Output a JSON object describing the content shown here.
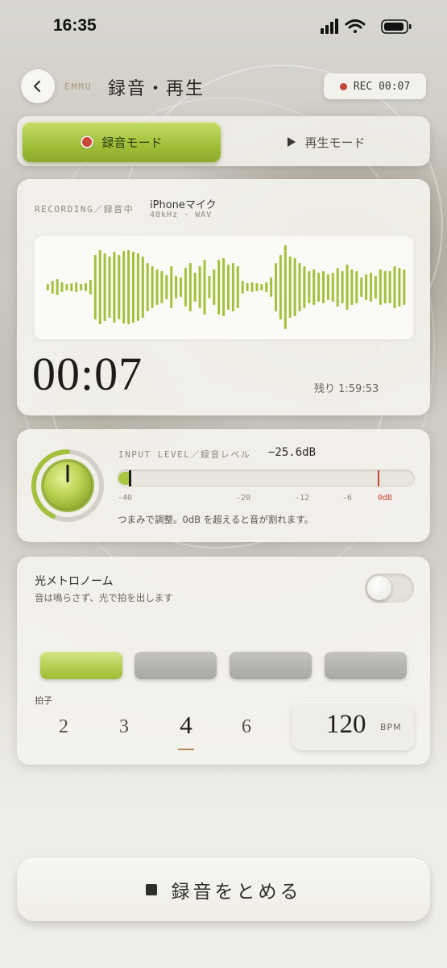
{
  "status_bar": {
    "time": "16:35",
    "icons": [
      "signal-icon",
      "wifi-icon",
      "battery-icon"
    ]
  },
  "header": {
    "brand": "EMMU",
    "title": "録音・再生",
    "rec_indicator": "REC 00:07"
  },
  "modes": {
    "record": "録音モード",
    "play": "再生モード",
    "active": "record"
  },
  "recording": {
    "status_label": "RECORDING／録音中",
    "mic_name": "iPhoneマイク",
    "mic_spec": "48kHz · WAV",
    "elapsed": "00:07",
    "remaining": "残り 1:59:53"
  },
  "input_level": {
    "label": "INPUT LEVEL／録音レベル",
    "value": "−25.6dB",
    "ticks": [
      "-40",
      "-20",
      "-12",
      "-6",
      "0dB"
    ],
    "hint": "つまみで調整。0dB を超えると音が割れます。"
  },
  "metronome": {
    "title": "光メトロノーム",
    "subtitle": "音は鳴らさず、光で拍を出します",
    "enabled": false,
    "beats_active": [
      true,
      false,
      false,
      false
    ],
    "time_signature_label": "拍子",
    "time_signatures": [
      "2",
      "3",
      "4",
      "6"
    ],
    "selected_signature": "4",
    "bpm": "120",
    "bpm_unit": "BPM"
  },
  "stop_button": {
    "label": "録音をとめる"
  },
  "colors": {
    "accent_green": "#a3c13c",
    "record_red": "#c3473a",
    "background": "#efede7"
  }
}
